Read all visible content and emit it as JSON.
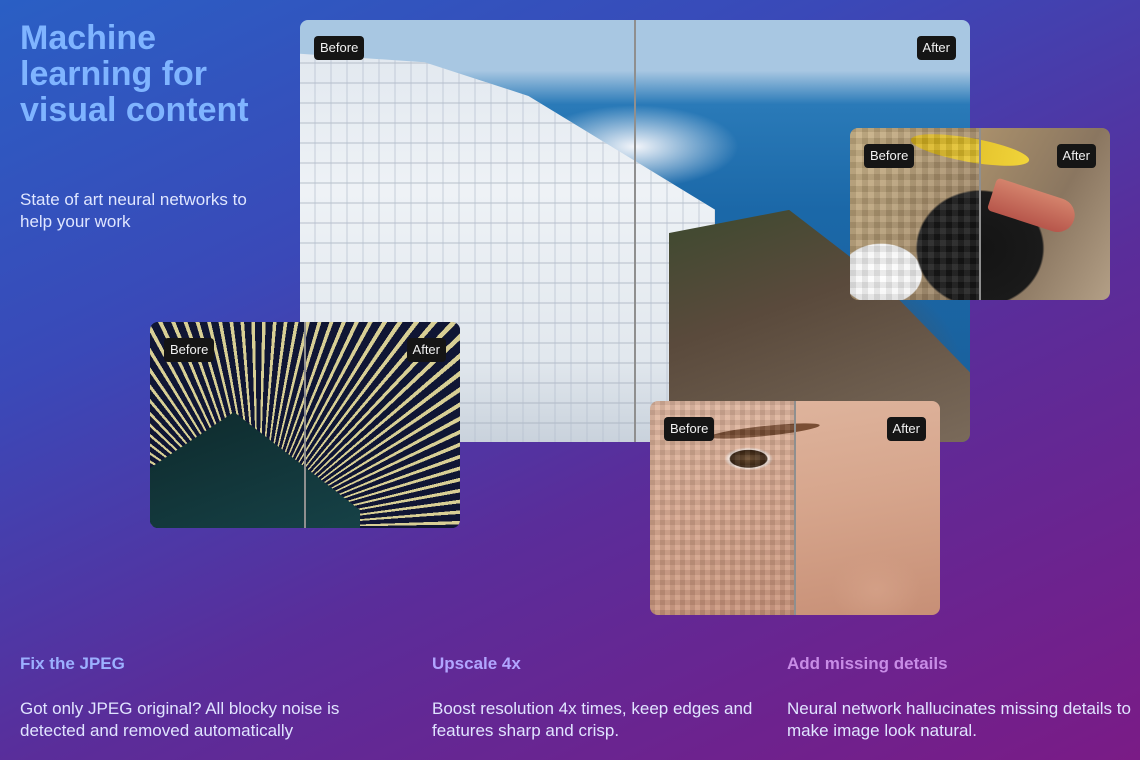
{
  "hero": {
    "title": "Machine learning for visual content",
    "subtitle": "State of art neural networks to help your work"
  },
  "comparisons": {
    "before_label": "Before",
    "after_label": "After",
    "items": [
      "santorini",
      "penguin",
      "light-rays",
      "face"
    ]
  },
  "features": [
    {
      "title": "Fix the JPEG",
      "description": "Got only JPEG original? All blocky noise is detected and removed automatically"
    },
    {
      "title": "Upscale 4x",
      "description": "Boost resolution 4x times, keep edges and features sharp and crisp."
    },
    {
      "title": "Add missing details",
      "description": "Neural network hallucinates missing details to make image look natural."
    }
  ],
  "colors": {
    "title": "#7fb4ff",
    "feature_1": "#9cb0ff",
    "feature_2": "#b1a5ff",
    "feature_3": "#c88ce6",
    "tag_bg": "#151515"
  }
}
